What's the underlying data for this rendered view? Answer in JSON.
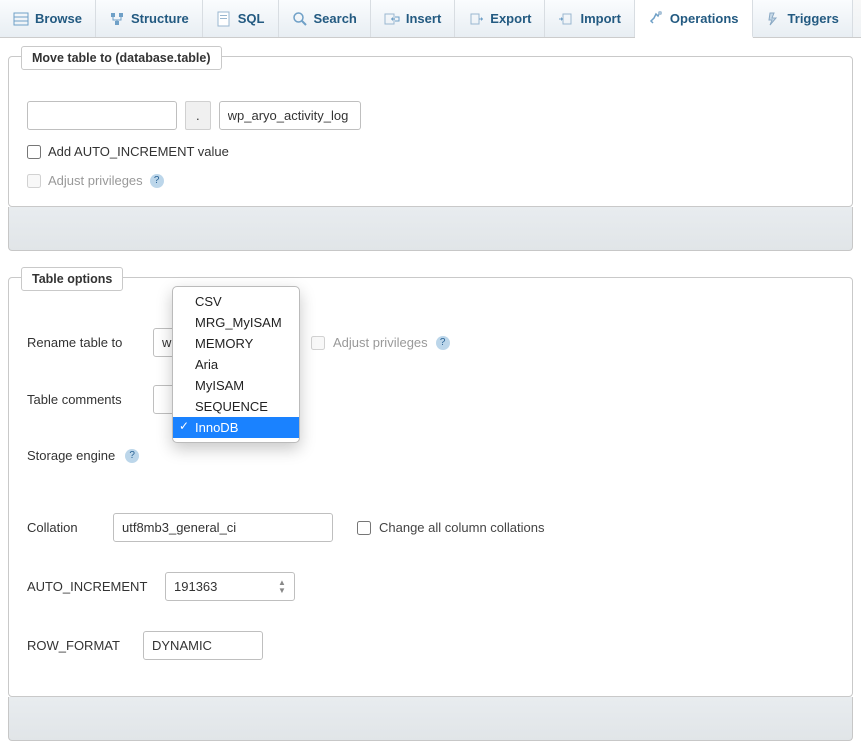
{
  "tabs": [
    {
      "label": "Browse",
      "icon": "browse-icon"
    },
    {
      "label": "Structure",
      "icon": "structure-icon"
    },
    {
      "label": "SQL",
      "icon": "sql-icon"
    },
    {
      "label": "Search",
      "icon": "search-icon"
    },
    {
      "label": "Insert",
      "icon": "insert-icon"
    },
    {
      "label": "Export",
      "icon": "export-icon"
    },
    {
      "label": "Import",
      "icon": "import-icon"
    },
    {
      "label": "Operations",
      "icon": "operations-icon",
      "active": true
    },
    {
      "label": "Triggers",
      "icon": "triggers-icon"
    }
  ],
  "moveTable": {
    "legend": "Move table to (database.table)",
    "dbValue": "",
    "dot": ".",
    "tableValue": "wp_aryo_activity_log",
    "addAutoInc": "Add AUTO_INCREMENT value",
    "adjustPriv": "Adjust privileges"
  },
  "tableOptions": {
    "legend": "Table options",
    "rename": {
      "label": "Rename table to",
      "value": "wp",
      "adjustPriv": "Adjust privileges"
    },
    "comments": {
      "label": "Table comments",
      "value": ""
    },
    "engine": {
      "label": "Storage engine"
    },
    "collation": {
      "label": "Collation",
      "value": "utf8mb3_general_ci",
      "changeAll": "Change all column collations"
    },
    "autoInc": {
      "label": "AUTO_INCREMENT",
      "value": "191363"
    },
    "rowFormat": {
      "label": "ROW_FORMAT",
      "value": "DYNAMIC"
    }
  },
  "engineDropdown": {
    "options": [
      "CSV",
      "MRG_MyISAM",
      "MEMORY",
      "Aria",
      "MyISAM",
      "SEQUENCE",
      "InnoDB"
    ],
    "selected": "InnoDB"
  }
}
